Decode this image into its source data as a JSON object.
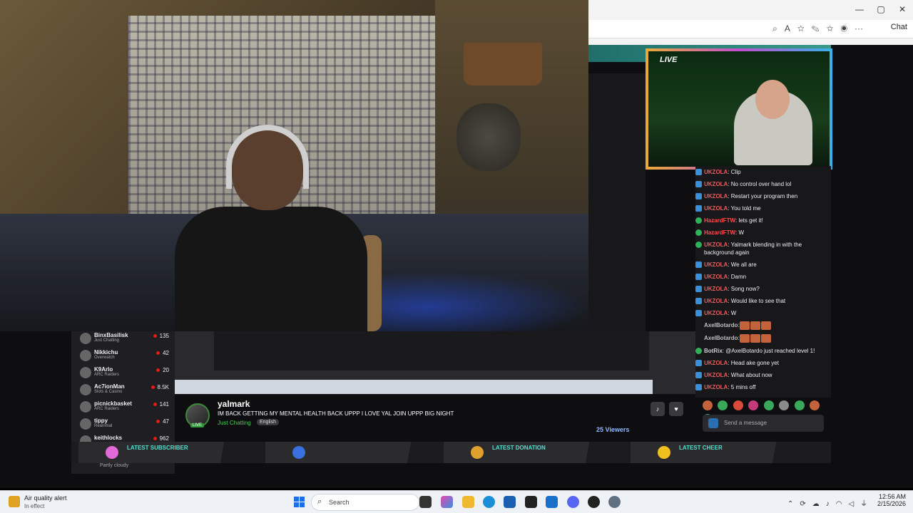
{
  "browser": {
    "win_min": "—",
    "win_max": "▢",
    "win_close": "✕",
    "chat_label": "Chat"
  },
  "stream_overlay": {
    "live_label": "LIVE"
  },
  "chat": {
    "messages": [
      {
        "user": "UKZOLA",
        "text": ": Clip",
        "badge": "blue",
        "style": ""
      },
      {
        "user": "UKZOLA",
        "text": ": No control over hand lol",
        "badge": "blue",
        "style": ""
      },
      {
        "user": "UKZOLA",
        "text": ": Restart your program then",
        "badge": "blue",
        "style": ""
      },
      {
        "user": "UKZOLA",
        "text": ": You told me",
        "badge": "blue",
        "style": ""
      },
      {
        "user": "HazardFTW",
        "text": ": lets get it!",
        "badge": "green",
        "style": "hz"
      },
      {
        "user": "HazardFTW",
        "text": ": W",
        "badge": "green",
        "style": "hz"
      },
      {
        "user": "UKZOLA",
        "text": ": Yalmark blending in with the background again",
        "badge": "green",
        "style": ""
      },
      {
        "user": "UKZOLA",
        "text": ": We all are",
        "badge": "blue",
        "style": ""
      },
      {
        "user": "UKZOLA",
        "text": ": Damn",
        "badge": "blue",
        "style": ""
      },
      {
        "user": "UKZOLA",
        "text": ": Song now?",
        "badge": "blue",
        "style": ""
      },
      {
        "user": "UKZOLA",
        "text": ": Would like to see that",
        "badge": "blue",
        "style": ""
      },
      {
        "user": "UKZOLA",
        "text": ": W",
        "badge": "blue",
        "style": ""
      },
      {
        "user": "AxelBotardo",
        "text": ":",
        "badge": "none",
        "style": "ax"
      },
      {
        "user": "AxelBotardo",
        "text": ":",
        "badge": "none",
        "style": "ax"
      },
      {
        "user": "BotRix",
        "text": ": @AxelBotardo just reached level 1!",
        "badge": "green",
        "style": "bot"
      },
      {
        "user": "UKZOLA",
        "text": ": Head ake gone yet",
        "badge": "blue",
        "style": ""
      },
      {
        "user": "UKZOLA",
        "text": ": What about now",
        "badge": "blue",
        "style": ""
      },
      {
        "user": "UKZOLA",
        "text": ": 5 mins off",
        "badge": "blue",
        "style": ""
      }
    ],
    "input_placeholder": "Send a message"
  },
  "following": [
    {
      "name": "BinxBasilisk",
      "category": "Just Chatting",
      "viewers": "135"
    },
    {
      "name": "Nikkichu",
      "category": "Overwatch",
      "viewers": "42"
    },
    {
      "name": "K9Arlo",
      "category": "ARC Raiders",
      "viewers": "20"
    },
    {
      "name": "Ac7ionMan",
      "category": "Slots & Casino",
      "viewers": "8.5K"
    },
    {
      "name": "picnickbasket",
      "category": "ARC Raiders",
      "viewers": "141"
    },
    {
      "name": "tippy",
      "category": "Reanimal",
      "viewers": "47"
    },
    {
      "name": "keithlocks",
      "category": "",
      "viewers": "962"
    }
  ],
  "stream_info": {
    "streamer": "yalmark",
    "title": "IM BACK GETTING MY MENTAL HEALTH BACK UPPP I LOVE YAL JOIN UPPP BIG NIGHT",
    "category": "Just Chatting",
    "language": "English",
    "live_pill": "LIVE",
    "viewers": "25 Viewers"
  },
  "overlay_bar": {
    "latest_subscriber": "LATEST SUBSCRIBER",
    "latest_donation": "LATEST DONATION",
    "latest_cheer": "LATEST CHEER"
  },
  "weather": "Partly cloudy",
  "taskbar": {
    "alert_title": "Air quality alert",
    "alert_sub": "In effect",
    "search_label": "Search",
    "time": "12:56 AM",
    "date": "2/15/2026"
  },
  "colors": {
    "accent_teal": "#4fe0d0",
    "twitch_live_red": "#e91916",
    "category_green": "#4fc95a"
  }
}
